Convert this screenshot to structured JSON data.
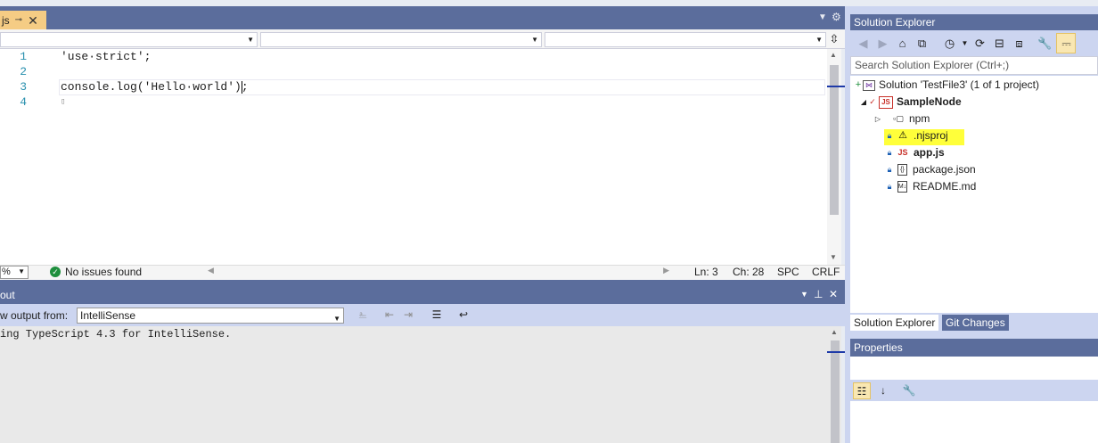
{
  "editor": {
    "tab_label": "js",
    "tab_pin_icon": "pin-icon",
    "tab_close_icon": "close-icon",
    "line_numbers": [
      "1",
      "2",
      "3",
      "4"
    ],
    "code_lines": [
      "'use·strict';",
      "",
      "console.log('Hello·world');",
      "▯"
    ],
    "status": {
      "zoom": "%",
      "issues": "No issues found",
      "line": "Ln: 3",
      "col": "Ch: 28",
      "whitespace": "SPC",
      "line_ending": "CRLF"
    }
  },
  "output": {
    "title": "out",
    "show_output_label": "w output from:",
    "source": "IntelliSense",
    "text": "ing TypeScript 4.3 for IntelliSense."
  },
  "solution_explorer": {
    "title": "Solution Explorer",
    "search_placeholder": "Search Solution Explorer (Ctrl+;)",
    "tree": {
      "solution": "Solution 'TestFile3' (1 of 1 project)",
      "project": "SampleNode",
      "npm": "npm",
      "njsproj": ".njsproj",
      "app": "app.js",
      "package": "package.json",
      "readme": "README.md"
    },
    "tabs": {
      "solution_explorer": "Solution Explorer",
      "git_changes": "Git Changes"
    }
  },
  "properties": {
    "title": "Properties"
  },
  "colors": {
    "title_bar": "#5b6d9c",
    "active_tab": "#f5cc84",
    "highlight": "#ffff3a",
    "line_number": "#2b91af"
  }
}
